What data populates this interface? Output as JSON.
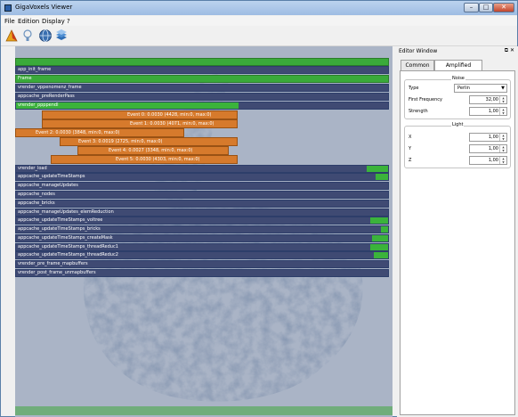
{
  "window": {
    "title": "GigaVoxels Viewer",
    "controls": {
      "minimize": "–",
      "maximize": "□",
      "close": "✕"
    }
  },
  "menu": [
    "File",
    "Edition",
    "Display",
    "?"
  ],
  "toolbar": {
    "icons": [
      "cone-icon",
      "lightbulb-icon",
      "globe-icon",
      "layers-icon"
    ],
    "colors": {
      "cone": "#e8a21a",
      "lightbulb": "#8fb4d9",
      "globe": "#3a6fb0",
      "layers": "#4f8fd3"
    }
  },
  "profiler": {
    "rows": [
      {
        "label": "",
        "value": "",
        "style": "green"
      },
      {
        "label": "app_init_frame",
        "value": "",
        "style": "plain"
      },
      {
        "label": "Frame",
        "value": "",
        "style": "green"
      },
      {
        "label": "vrender_vppenomenz_frame",
        "value": "",
        "style": "plain"
      },
      {
        "label": "appcache_preRenderPass",
        "value": "",
        "style": "plain"
      },
      {
        "label": "vrender_ppppendl",
        "value": "",
        "style": "green-partial"
      }
    ],
    "events": [
      "Event 0: 0.0030 (4428, min:0, max:0)",
      "Event 1: 0.0030 (4071, min:0, max:0)",
      "Event 2: 0.0030 (3848, min:0, max:0)",
      "Event 3: 0.0019 (2725, min:0, max:0)",
      "Event 4: 0.0027 (3348, min:0, max:0)",
      "Event 5: 0.0030 (4303, min:0, max:0)"
    ],
    "lower_rows": [
      "vrender_load",
      "appcache_updateTimeStamps",
      "appcache_manageUpdates",
      "appcache_nodes",
      "appcache_bricks",
      "appcache_manageUpdates_elemReduction",
      "appcache_updateTimeStamps_voltree",
      "appcache_updateTimeStamps_bricks",
      "appcache_updateTimeStamps_createMask",
      "appcache_updateTimeStamps_threadReduc1",
      "appcache_updateTimeStamps_threadReduc2",
      "vrender_pre_frame_mapbuffers",
      "vrender_post_frame_unmapbuffers"
    ]
  },
  "editor": {
    "title": "Editor Window",
    "icons": [
      "float-icon",
      "close-icon"
    ],
    "tabs": [
      "Common",
      "Amplified Volume"
    ],
    "active_tab": 1,
    "noise": {
      "title": "Noise",
      "type_label": "Type",
      "type_value": "Perlin",
      "first_frequency_label": "First Frequency",
      "first_frequency_value": "32,00",
      "strength_label": "Strength",
      "strength_value": "1,00"
    },
    "light": {
      "title": "Light",
      "x_label": "X",
      "x_value": "1,00",
      "y_label": "Y",
      "y_value": "1,00",
      "z_label": "Z",
      "z_value": "1,00"
    }
  }
}
